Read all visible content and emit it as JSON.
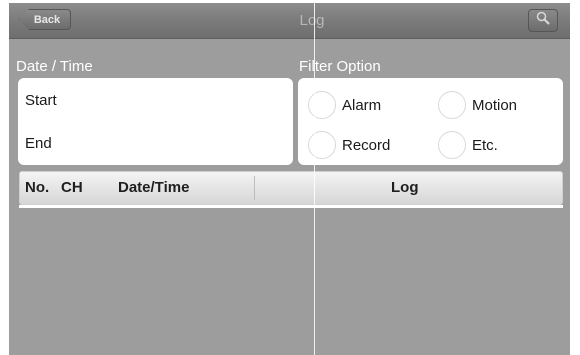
{
  "navbar": {
    "back_label": "Back",
    "title": "Log",
    "search_icon": "search-icon"
  },
  "date_time": {
    "section_label": "Date / Time",
    "start_label": "Start",
    "end_label": "End"
  },
  "filter": {
    "section_label": "Filter Option",
    "options": [
      {
        "label": "Alarm"
      },
      {
        "label": "Motion"
      },
      {
        "label": "Record"
      },
      {
        "label": "Etc."
      }
    ]
  },
  "log_table": {
    "columns": [
      "No.",
      "CH",
      "Date/Time",
      "Log"
    ],
    "rows": []
  },
  "colors": {
    "background": "#9d9d9d",
    "navbar": "#7b7b7b",
    "panel": "#ffffff"
  }
}
